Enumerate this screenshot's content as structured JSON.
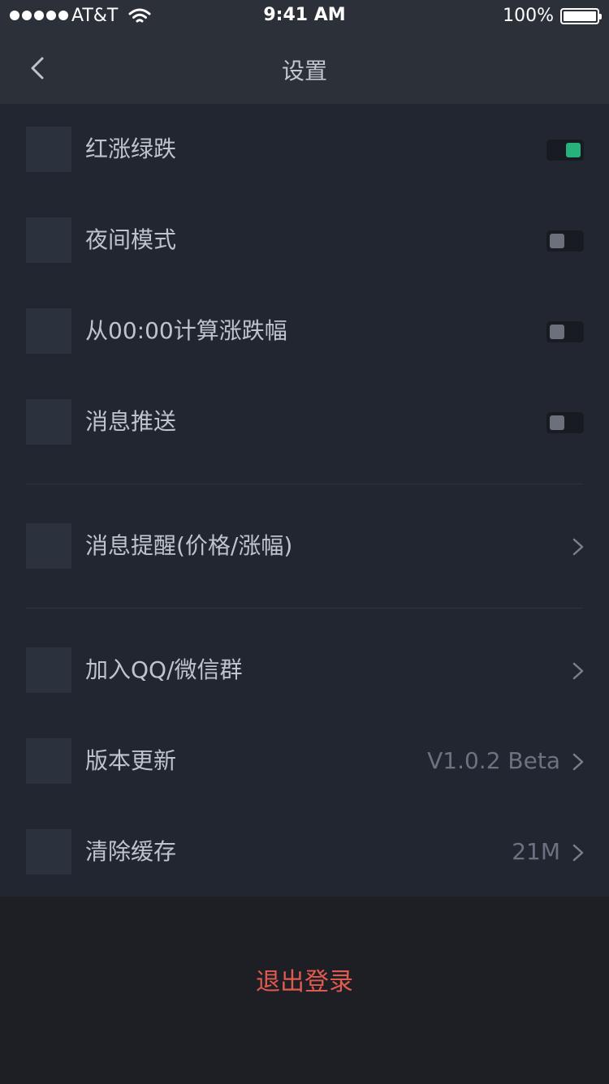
{
  "status_bar": {
    "carrier": "AT&T",
    "time": "9:41 AM",
    "battery": "100%"
  },
  "nav": {
    "title": "设置",
    "back_icon": "chevron-left-icon"
  },
  "settings": {
    "toggles": [
      {
        "label": "红涨绿跌",
        "on": true
      },
      {
        "label": "夜间模式",
        "on": false
      },
      {
        "label": "从00:00计算涨跌幅",
        "on": false
      },
      {
        "label": "消息推送",
        "on": false
      }
    ],
    "alert": {
      "label": "消息提醒(价格/涨幅)"
    },
    "links": [
      {
        "label": "加入QQ/微信群",
        "value": ""
      },
      {
        "label": "版本更新",
        "value": "V1.0.2 Beta"
      },
      {
        "label": "清除缓存",
        "value": "21M"
      }
    ]
  },
  "logout": {
    "label": "退出登录"
  },
  "colors": {
    "accent_on": "#27b27c",
    "logout": "#e15a4f",
    "background": "#222630"
  }
}
